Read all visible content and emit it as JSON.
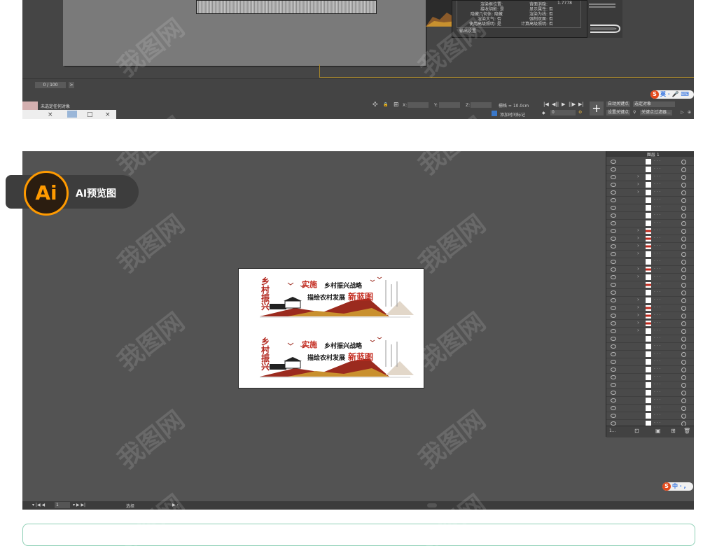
{
  "colors": {
    "max_bg": "#454545",
    "ai_bg": "#535353",
    "accent_red": "#9b2a1e",
    "accent_orange": "#ff9a00",
    "ime_red": "#e44a1c",
    "ime_blue": "#2a6de0"
  },
  "max": {
    "render_dialog": {
      "rows": [
        [
          "渲染框位置:",
          "背面消隐:",
          "1.7778"
        ],
        [
          "接收阴影: 是",
          "显示属性: 否",
          ""
        ],
        [
          "隐藏几何体: 隐藏",
          "渲染为线: 否",
          ""
        ],
        [
          "渲染大气: 否",
          "强制双面: 否",
          ""
        ],
        [
          "使用高级照明: 是",
          "计算高级照明: 否",
          ""
        ]
      ],
      "footer": "输出设置"
    },
    "frame_counter": "0 / 100",
    "status_message": "未选定任何对象",
    "coord_labels": [
      "X:",
      "Y:",
      "Z:"
    ],
    "grid_label": "栅格 = 10.0cm",
    "add_time_tag": "添加时间标记",
    "frame_value": "0",
    "auto_key": "自动关键点",
    "set_key": "设置关键点",
    "selection_dropdown": "选定对象",
    "key_filter": "关键点过滤器...",
    "window_tabs": [
      "×",
      "□",
      "×"
    ]
  },
  "ime_top": {
    "logo": "S",
    "text": "英 · 🎤 ⌨"
  },
  "ime_bottom": {
    "logo": "S",
    "text": "中 · ,"
  },
  "ai": {
    "badge_icon": "Ai",
    "badge_label": "AI预览图",
    "layer_top": "图层 1",
    "status_zoom": "1",
    "status_tool": "选择"
  },
  "design": {
    "vertical_title": "乡村振兴",
    "headline_red": "实施",
    "headline_black": "乡村振兴战略",
    "sub_black": "描绘农村发展",
    "sub_red": "新蓝图"
  },
  "watermark": "我图网",
  "icons": [
    "play-icon",
    "prev-frame-icon",
    "next-frame-icon",
    "add-key-icon",
    "eye-icon",
    "expand-arrow-icon",
    "target-circle-icon",
    "ime-logo-icon"
  ]
}
